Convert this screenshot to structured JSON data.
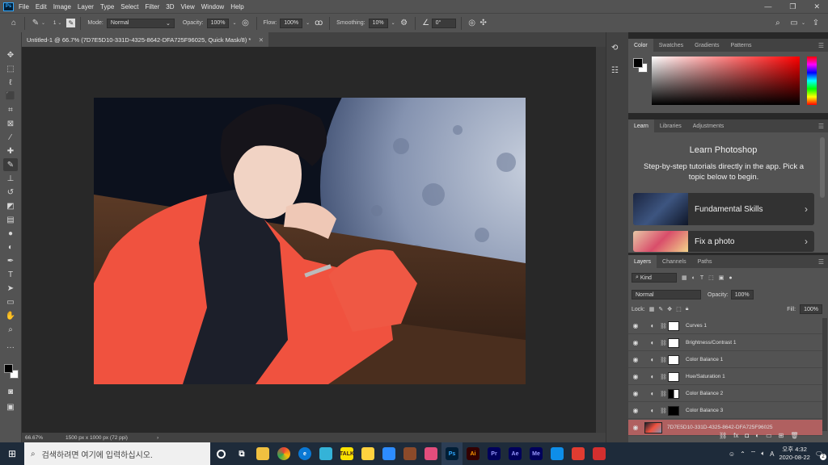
{
  "app": {
    "logo": "Ps"
  },
  "menu": [
    "File",
    "Edit",
    "Image",
    "Layer",
    "Type",
    "Select",
    "Filter",
    "3D",
    "View",
    "Window",
    "Help"
  ],
  "options": {
    "brush_size": "1",
    "mode_label": "Mode:",
    "mode_value": "Normal",
    "opacity_label": "Opacity:",
    "opacity_value": "100%",
    "flow_label": "Flow:",
    "flow_value": "100%",
    "smoothing_label": "Smoothing:",
    "smoothing_value": "10%",
    "angle_value": "0°"
  },
  "document": {
    "tab_title": "Untitled-1 @ 66.7% (7D7E5D10-331D-4325-8642-DFA725F96025, Quick Mask/8) *",
    "zoom": "66.67%",
    "dimensions": "1500 px x 1000 px (72 ppi)"
  },
  "color_panel": {
    "tabs": [
      "Color",
      "Swatches",
      "Gradients",
      "Patterns"
    ],
    "active_tab": "Color",
    "colors": {
      "foreground": "#000000",
      "background": "#ffffff",
      "picker_hue": "#ff0000"
    }
  },
  "learn_panel": {
    "tabs": [
      "Learn",
      "Libraries",
      "Adjustments"
    ],
    "title": "Learn Photoshop",
    "description": "Step-by-step tutorials directly in the app. Pick a topic below to begin.",
    "cards": [
      "Fundamental Skills",
      "Fix a photo"
    ]
  },
  "layers_panel": {
    "tabs": [
      "Layers",
      "Channels",
      "Paths"
    ],
    "filter_kind": "Kind",
    "blend_mode": "Normal",
    "opacity_label": "Opacity:",
    "opacity_value": "100%",
    "lock_label": "Lock:",
    "fill_label": "Fill:",
    "fill_value": "100%",
    "layers": [
      {
        "name": "Curves 1"
      },
      {
        "name": "Brightness/Contrast 1"
      },
      {
        "name": "Color Balance 1"
      },
      {
        "name": "Hue/Saturation 1"
      },
      {
        "name": "Color Balance 2"
      },
      {
        "name": "Color Balance 3"
      },
      {
        "name": "7D7E5D10-331D-4325-8642-DFA725F96025"
      }
    ]
  },
  "taskbar": {
    "search_placeholder": "검색하려면 여기에 입력하십시오.",
    "time": "오후 4:32",
    "date": "2020-08-22",
    "ime": "A",
    "notifications": "2",
    "apps": [
      "Ps",
      "Ai",
      "Pr",
      "Ae",
      "Me"
    ]
  }
}
